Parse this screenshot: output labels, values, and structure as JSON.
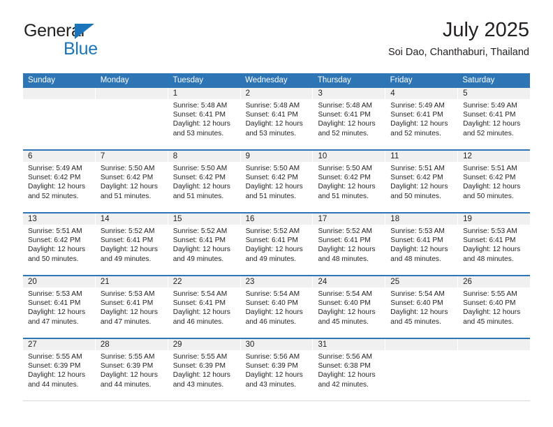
{
  "brand": {
    "name_top": "General",
    "name_bottom": "Blue",
    "triangle_color": "#1b75bb"
  },
  "header": {
    "title": "July 2025",
    "location": "Soi Dao, Chanthaburi, Thailand"
  },
  "theme": {
    "header_blue": "#2e75b6",
    "daynum_band": "#f0f0f0",
    "text": "#231f20"
  },
  "calendar": {
    "weekday_headers": [
      "Sunday",
      "Monday",
      "Tuesday",
      "Wednesday",
      "Thursday",
      "Friday",
      "Saturday"
    ],
    "weeks": [
      [
        {
          "day": ""
        },
        {
          "day": ""
        },
        {
          "day": "1",
          "sunrise": "Sunrise: 5:48 AM",
          "sunset": "Sunset: 6:41 PM",
          "daylight_1": "Daylight: 12 hours",
          "daylight_2": "and 53 minutes."
        },
        {
          "day": "2",
          "sunrise": "Sunrise: 5:48 AM",
          "sunset": "Sunset: 6:41 PM",
          "daylight_1": "Daylight: 12 hours",
          "daylight_2": "and 53 minutes."
        },
        {
          "day": "3",
          "sunrise": "Sunrise: 5:48 AM",
          "sunset": "Sunset: 6:41 PM",
          "daylight_1": "Daylight: 12 hours",
          "daylight_2": "and 52 minutes."
        },
        {
          "day": "4",
          "sunrise": "Sunrise: 5:49 AM",
          "sunset": "Sunset: 6:41 PM",
          "daylight_1": "Daylight: 12 hours",
          "daylight_2": "and 52 minutes."
        },
        {
          "day": "5",
          "sunrise": "Sunrise: 5:49 AM",
          "sunset": "Sunset: 6:41 PM",
          "daylight_1": "Daylight: 12 hours",
          "daylight_2": "and 52 minutes."
        }
      ],
      [
        {
          "day": "6",
          "sunrise": "Sunrise: 5:49 AM",
          "sunset": "Sunset: 6:42 PM",
          "daylight_1": "Daylight: 12 hours",
          "daylight_2": "and 52 minutes."
        },
        {
          "day": "7",
          "sunrise": "Sunrise: 5:50 AM",
          "sunset": "Sunset: 6:42 PM",
          "daylight_1": "Daylight: 12 hours",
          "daylight_2": "and 51 minutes."
        },
        {
          "day": "8",
          "sunrise": "Sunrise: 5:50 AM",
          "sunset": "Sunset: 6:42 PM",
          "daylight_1": "Daylight: 12 hours",
          "daylight_2": "and 51 minutes."
        },
        {
          "day": "9",
          "sunrise": "Sunrise: 5:50 AM",
          "sunset": "Sunset: 6:42 PM",
          "daylight_1": "Daylight: 12 hours",
          "daylight_2": "and 51 minutes."
        },
        {
          "day": "10",
          "sunrise": "Sunrise: 5:50 AM",
          "sunset": "Sunset: 6:42 PM",
          "daylight_1": "Daylight: 12 hours",
          "daylight_2": "and 51 minutes."
        },
        {
          "day": "11",
          "sunrise": "Sunrise: 5:51 AM",
          "sunset": "Sunset: 6:42 PM",
          "daylight_1": "Daylight: 12 hours",
          "daylight_2": "and 50 minutes."
        },
        {
          "day": "12",
          "sunrise": "Sunrise: 5:51 AM",
          "sunset": "Sunset: 6:42 PM",
          "daylight_1": "Daylight: 12 hours",
          "daylight_2": "and 50 minutes."
        }
      ],
      [
        {
          "day": "13",
          "sunrise": "Sunrise: 5:51 AM",
          "sunset": "Sunset: 6:42 PM",
          "daylight_1": "Daylight: 12 hours",
          "daylight_2": "and 50 minutes."
        },
        {
          "day": "14",
          "sunrise": "Sunrise: 5:52 AM",
          "sunset": "Sunset: 6:41 PM",
          "daylight_1": "Daylight: 12 hours",
          "daylight_2": "and 49 minutes."
        },
        {
          "day": "15",
          "sunrise": "Sunrise: 5:52 AM",
          "sunset": "Sunset: 6:41 PM",
          "daylight_1": "Daylight: 12 hours",
          "daylight_2": "and 49 minutes."
        },
        {
          "day": "16",
          "sunrise": "Sunrise: 5:52 AM",
          "sunset": "Sunset: 6:41 PM",
          "daylight_1": "Daylight: 12 hours",
          "daylight_2": "and 49 minutes."
        },
        {
          "day": "17",
          "sunrise": "Sunrise: 5:52 AM",
          "sunset": "Sunset: 6:41 PM",
          "daylight_1": "Daylight: 12 hours",
          "daylight_2": "and 48 minutes."
        },
        {
          "day": "18",
          "sunrise": "Sunrise: 5:53 AM",
          "sunset": "Sunset: 6:41 PM",
          "daylight_1": "Daylight: 12 hours",
          "daylight_2": "and 48 minutes."
        },
        {
          "day": "19",
          "sunrise": "Sunrise: 5:53 AM",
          "sunset": "Sunset: 6:41 PM",
          "daylight_1": "Daylight: 12 hours",
          "daylight_2": "and 48 minutes."
        }
      ],
      [
        {
          "day": "20",
          "sunrise": "Sunrise: 5:53 AM",
          "sunset": "Sunset: 6:41 PM",
          "daylight_1": "Daylight: 12 hours",
          "daylight_2": "and 47 minutes."
        },
        {
          "day": "21",
          "sunrise": "Sunrise: 5:53 AM",
          "sunset": "Sunset: 6:41 PM",
          "daylight_1": "Daylight: 12 hours",
          "daylight_2": "and 47 minutes."
        },
        {
          "day": "22",
          "sunrise": "Sunrise: 5:54 AM",
          "sunset": "Sunset: 6:41 PM",
          "daylight_1": "Daylight: 12 hours",
          "daylight_2": "and 46 minutes."
        },
        {
          "day": "23",
          "sunrise": "Sunrise: 5:54 AM",
          "sunset": "Sunset: 6:40 PM",
          "daylight_1": "Daylight: 12 hours",
          "daylight_2": "and 46 minutes."
        },
        {
          "day": "24",
          "sunrise": "Sunrise: 5:54 AM",
          "sunset": "Sunset: 6:40 PM",
          "daylight_1": "Daylight: 12 hours",
          "daylight_2": "and 45 minutes."
        },
        {
          "day": "25",
          "sunrise": "Sunrise: 5:54 AM",
          "sunset": "Sunset: 6:40 PM",
          "daylight_1": "Daylight: 12 hours",
          "daylight_2": "and 45 minutes."
        },
        {
          "day": "26",
          "sunrise": "Sunrise: 5:55 AM",
          "sunset": "Sunset: 6:40 PM",
          "daylight_1": "Daylight: 12 hours",
          "daylight_2": "and 45 minutes."
        }
      ],
      [
        {
          "day": "27",
          "sunrise": "Sunrise: 5:55 AM",
          "sunset": "Sunset: 6:39 PM",
          "daylight_1": "Daylight: 12 hours",
          "daylight_2": "and 44 minutes."
        },
        {
          "day": "28",
          "sunrise": "Sunrise: 5:55 AM",
          "sunset": "Sunset: 6:39 PM",
          "daylight_1": "Daylight: 12 hours",
          "daylight_2": "and 44 minutes."
        },
        {
          "day": "29",
          "sunrise": "Sunrise: 5:55 AM",
          "sunset": "Sunset: 6:39 PM",
          "daylight_1": "Daylight: 12 hours",
          "daylight_2": "and 43 minutes."
        },
        {
          "day": "30",
          "sunrise": "Sunrise: 5:56 AM",
          "sunset": "Sunset: 6:39 PM",
          "daylight_1": "Daylight: 12 hours",
          "daylight_2": "and 43 minutes."
        },
        {
          "day": "31",
          "sunrise": "Sunrise: 5:56 AM",
          "sunset": "Sunset: 6:38 PM",
          "daylight_1": "Daylight: 12 hours",
          "daylight_2": "and 42 minutes."
        },
        {
          "day": ""
        },
        {
          "day": ""
        }
      ]
    ]
  }
}
